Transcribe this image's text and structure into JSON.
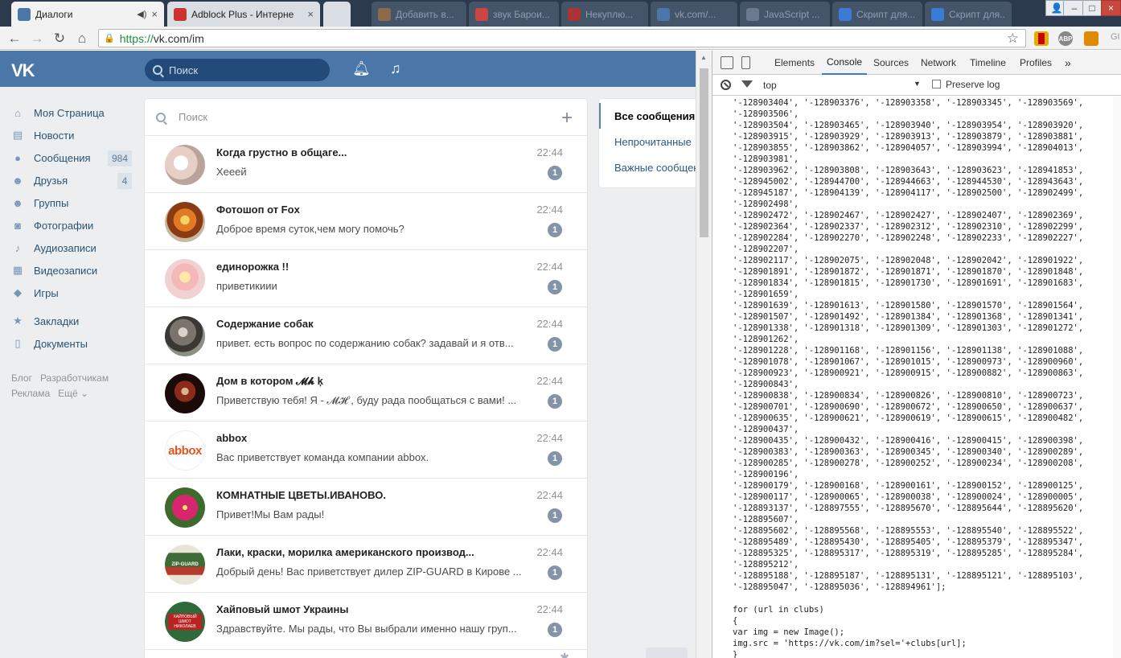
{
  "browser": {
    "tabs": [
      {
        "title": "Диалоги",
        "favicon_color": "#4a76a8",
        "active": true,
        "close": "×"
      },
      {
        "title": "Adblock Plus - Интерне",
        "favicon_color": "#c33",
        "active": false,
        "close": "×"
      },
      {
        "title": "",
        "favicon_color": "#d9dde4",
        "active": false,
        "close": ""
      },
      {
        "title": "Добавить в...",
        "favicon_color": "#8a6b4a",
        "active": false,
        "close": ""
      },
      {
        "title": "звук Барои...",
        "favicon_color": "#c44",
        "active": false,
        "close": ""
      },
      {
        "title": "Некуплю...",
        "favicon_color": "#a33",
        "active": false,
        "close": ""
      },
      {
        "title": "vk.com/...",
        "favicon_color": "#4a76a8",
        "active": false,
        "close": ""
      },
      {
        "title": "JavaScript ...",
        "favicon_color": "#6b7a8f",
        "active": false,
        "close": ""
      },
      {
        "title": "Скрипт для...",
        "favicon_color": "#3a7bd5",
        "active": false,
        "close": ""
      },
      {
        "title": "Скрипт для...",
        "favicon_color": "#3a7bd5",
        "active": false,
        "close": ""
      }
    ],
    "window_controls": {
      "user": "👤",
      "minimize": "–",
      "maximize": "□",
      "close": "×"
    },
    "url_scheme": "https://",
    "url_rest": "vk.com/im",
    "nav": {
      "back": "←",
      "forward": "→",
      "reload": "↻",
      "home": "⌂"
    },
    "extensions": [
      {
        "name": "bookmark-ext",
        "label": "",
        "color": "#e0b000"
      },
      {
        "name": "abp-ext",
        "label": "ABP",
        "color": "#888"
      },
      {
        "name": "fox-ext",
        "label": "",
        "color": "#e08a00"
      }
    ],
    "partial_right_text": "GI"
  },
  "vk": {
    "search_placeholder": "Поиск",
    "menu": [
      {
        "label": "Моя Страница",
        "icon": "home-icon",
        "glyph": "⌂",
        "count": ""
      },
      {
        "label": "Новости",
        "icon": "news-icon",
        "glyph": "▤",
        "count": ""
      },
      {
        "label": "Сообщения",
        "icon": "messages-icon",
        "glyph": "●",
        "count": "984"
      },
      {
        "label": "Друзья",
        "icon": "friends-icon",
        "glyph": "☻",
        "count": "4"
      },
      {
        "label": "Группы",
        "icon": "groups-icon",
        "glyph": "☻",
        "count": ""
      },
      {
        "label": "Фотографии",
        "icon": "photos-icon",
        "glyph": "◙",
        "count": ""
      },
      {
        "label": "Аудиозаписи",
        "icon": "audio-icon",
        "glyph": "♪",
        "count": ""
      },
      {
        "label": "Видеозаписи",
        "icon": "video-icon",
        "glyph": "▦",
        "count": ""
      },
      {
        "label": "Игры",
        "icon": "games-icon",
        "glyph": "◆",
        "count": ""
      }
    ],
    "menu2": [
      {
        "label": "Закладки",
        "icon": "bookmarks-icon",
        "glyph": "★"
      },
      {
        "label": "Документы",
        "icon": "documents-icon",
        "glyph": "▯"
      }
    ],
    "footer_links": [
      "Блог",
      "Разработчикам",
      "Реклама",
      "Ещё ⌄"
    ],
    "dialogs_search_placeholder": "Поиск",
    "dialogs": [
      {
        "name": "Когда грустно в общаге...",
        "time": "22:44",
        "text": "Хееей",
        "unread": "1",
        "avatar_color": "#e8d9d0"
      },
      {
        "name": "Фотошоп от Fox",
        "time": "22:44",
        "text": "Доброе время суток,чем могу помочь?",
        "unread": "1",
        "avatar_color": "#d98a2a"
      },
      {
        "name": "единорожка !!",
        "time": "22:44",
        "text": "приветикиии",
        "unread": "1",
        "avatar_color": "#f1c6c6"
      },
      {
        "name": "Содержание собак",
        "time": "22:44",
        "text": "привет. есть вопрос по содержанию собак? задавай и я отв...",
        "unread": "1",
        "avatar_color": "#6b6660"
      },
      {
        "name": "Дом в котором 𝓜𝓱 ķ",
        "time": "22:44",
        "text": "Приветствую тебя! Я - 𝓜𝓗 , буду рада пообщаться с вами! ...",
        "unread": "1",
        "avatar_color": "#2a1210"
      },
      {
        "name": "abbox",
        "time": "22:44",
        "text": "Вас приветствует команда компании abbox.",
        "unread": "1",
        "avatar_color": "#ffffff"
      },
      {
        "name": "КОМНАТНЫЕ ЦВЕТЫ.ИВАНОВО.",
        "time": "22:44",
        "text": "Привет!Мы Вам рады!",
        "unread": "1",
        "avatar_color": "#c9307a"
      },
      {
        "name": "Лаки, краски, морилка американского производ...",
        "time": "22:44",
        "text": "Добрый день! Вас приветствует дилер ZIP-GUARD в Кирове ...",
        "unread": "1",
        "avatar_color": "#3f6b39"
      },
      {
        "name": "Хайповый шмот Украины",
        "time": "22:44",
        "text": "Здравствуйте. Мы рады, что Вы выбрали именно нашу груп...",
        "unread": "1",
        "avatar_color": "#2f6b3a"
      }
    ],
    "avatar_texts": {
      "abbox": "abbox",
      "zip": "ZIP-GUARD",
      "hype": "ХАЙПОВЫЙ ШМОТ НИКОЛАЕВ"
    },
    "filters": [
      "Все сообщения",
      "Непрочитанные",
      "Важные сообщения"
    ]
  },
  "devtools": {
    "tabs": [
      "Elements",
      "Console",
      "Sources",
      "Network",
      "Timeline",
      "Profiles"
    ],
    "more": "»",
    "active_tab": "Console",
    "context": "top",
    "preserve_log": "Preserve log",
    "console_lines": [
      "'-128903404', '-128903376', '-128903358', '-128903345', '-128903569',",
      "'-128903506',",
      "'-128903504', '-128903465', '-128903940', '-128903954', '-128903920',",
      "'-128903915', '-128903929', '-128903913', '-128903879', '-128903881',",
      "'-128903855', '-128903862', '-128904057', '-128903994', '-128904013',",
      "'-128903981',",
      "'-128903962', '-128903808', '-128903643', '-128903623', '-128941853',",
      "'-128945002', '-128944700', '-128944663', '-128944530', '-128943643',",
      "'-128945187', '-128904139', '-128904117', '-128902500', '-128902499',",
      "'-128902498',",
      "'-128902472', '-128902467', '-128902427', '-128902407', '-128902369',",
      "'-128902364', '-128902337', '-128902312', '-128902310', '-128902299',",
      "'-128902284', '-128902270', '-128902248', '-128902233', '-128902227',",
      "'-128902207',",
      "'-128902117', '-128902075', '-128902048', '-128902042', '-128901922',",
      "'-128901891', '-128901872', '-128901871', '-128901870', '-128901848',",
      "'-128901834', '-128901815', '-128901730', '-128901691', '-128901683',",
      "'-128901659',",
      "'-128901639', '-128901613', '-128901580', '-128901570', '-128901564',",
      "'-128901507', '-128901492', '-128901384', '-128901368', '-128901341',",
      "'-128901338', '-128901318', '-128901309', '-128901303', '-128901272',",
      "'-128901262',",
      "'-128901228', '-128901168', '-128901156', '-128901138', '-128901088',",
      "'-128901078', '-128901067', '-128901015', '-128900973', '-128900960',",
      "'-128900923', '-128900921', '-128900915', '-128900882', '-128900863',",
      "'-128900843',",
      "'-128900838', '-128900834', '-128900826', '-128900810', '-128900723',",
      "'-128900701', '-128900690', '-128900672', '-128900650', '-128900637',",
      "'-128900635', '-128900621', '-128900619', '-128900615', '-128900482',",
      "'-128900437',",
      "'-128900435', '-128900432', '-128900416', '-128900415', '-128900398',",
      "'-128900383', '-128900363', '-128900345', '-128900340', '-128900289',",
      "'-128900285', '-128900278', '-128900252', '-128900234', '-128900208',",
      "'-128900196',",
      "'-128900179', '-128900168', '-128900161', '-128900152', '-128900125',",
      "'-128900117', '-128900065', '-128900038', '-128900024', '-128900005',",
      "'-128893137', '-128897555', '-128895670', '-128895644', '-128895620',",
      "'-128895607',",
      "'-128895602', '-128895568', '-128895553', '-128895540', '-128895522',",
      "'-128895489', '-128895430', '-128895405', '-128895379', '-128895347',",
      "'-128895325', '-128895317', '-128895319', '-128895285', '-128895284',",
      "'-128895212',",
      "'-128895188', '-128895187', '-128895131', '-128895121', '-128895103',",
      "'-128895047', '-128895036', '-128894961'];",
      "",
      "for (url in clubs)",
      "{",
      "var img = new Image();",
      "img.src = 'https://vk.com/im?sel='+clubs[url];",
      "}"
    ]
  }
}
